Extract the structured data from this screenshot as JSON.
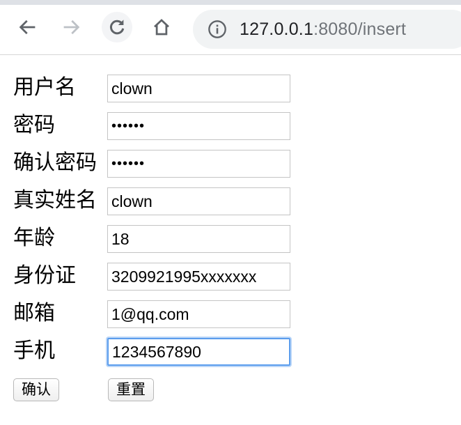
{
  "browser": {
    "url_host": "127.0.0.1",
    "url_rest": ":8080/insert",
    "icons": [
      "back-arrow-icon",
      "forward-arrow-icon",
      "reload-icon",
      "home-icon",
      "info-icon"
    ]
  },
  "form": {
    "fields": [
      {
        "label": "用户名",
        "value": "clown",
        "type": "text"
      },
      {
        "label": "密码",
        "value": "••••••",
        "type": "password"
      },
      {
        "label": "确认密码",
        "value": "••••••",
        "type": "password"
      },
      {
        "label": "真实姓名",
        "value": "clown",
        "type": "text"
      },
      {
        "label": "年龄",
        "value": "18",
        "type": "text"
      },
      {
        "label": "身份证",
        "value": "3209921995xxxxxxx",
        "type": "text"
      },
      {
        "label": "邮箱",
        "value": "1@qq.com",
        "type": "text"
      },
      {
        "label": "手机",
        "value": "1234567890",
        "type": "text",
        "focused": true
      }
    ],
    "submit_label": "确认",
    "reset_label": "重置"
  },
  "colors": {
    "focus_ring": "#5b9ded",
    "url_muted": "#6f7378",
    "chrome_bg": "#dee1e6"
  }
}
